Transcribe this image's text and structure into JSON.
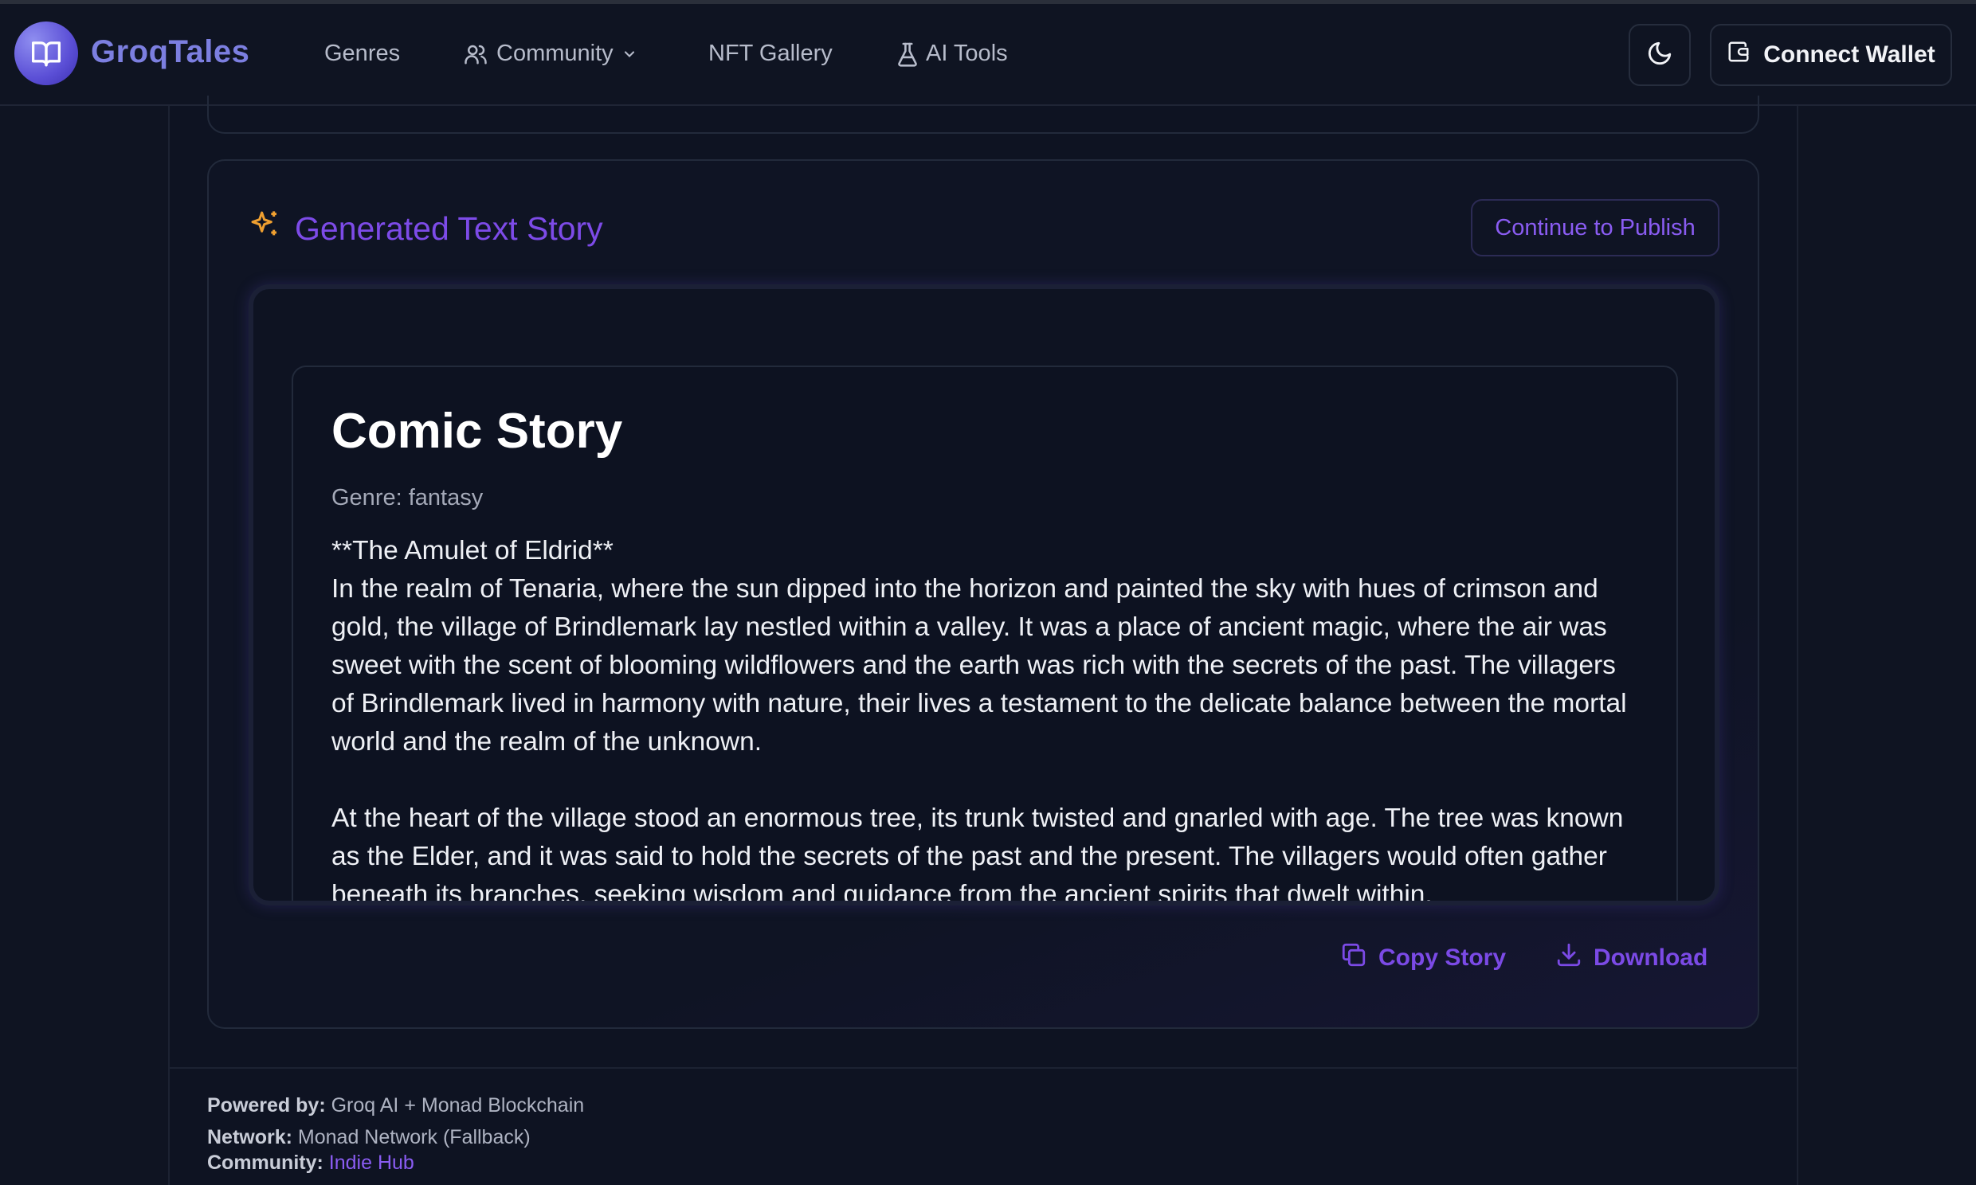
{
  "nav": {
    "brand": "GroqTales",
    "links": {
      "genres": "Genres",
      "community": "Community",
      "nft_gallery": "NFT Gallery",
      "ai_tools": "AI Tools"
    },
    "wallet_button": "Connect Wallet"
  },
  "card": {
    "title": "Generated Text Story",
    "publish_button": "Continue to Publish",
    "story": {
      "title": "Comic Story",
      "genre_label": "Genre: fantasy",
      "heading": "**The Amulet of Eldrid**",
      "paragraph1": "In the realm of Tenaria, where the sun dipped into the horizon and painted the sky with hues of crimson and gold, the village of Brindlemark lay nestled within a valley. It was a place of ancient magic, where the air was sweet with the scent of blooming wildflowers and the earth was rich with the secrets of the past. The villagers of Brindlemark lived in harmony with nature, their lives a testament to the delicate balance between the mortal world and the realm of the unknown.",
      "paragraph2": "At the heart of the village stood an enormous tree, its trunk twisted and gnarled with age. The tree was known as the Elder, and it was said to hold the secrets of the past and the present. The villagers would often gather beneath its branches, seeking wisdom and guidance from the ancient spirits that dwelt within."
    },
    "actions": {
      "copy": "Copy Story",
      "download": "Download"
    }
  },
  "footer": {
    "powered_label": "Powered by:",
    "powered_value": "Groq AI + Monad Blockchain",
    "network_label": "Network:",
    "network_value": "Monad Network (Fallback)",
    "community_label": "Community:",
    "community_value": "Indie Hub"
  },
  "colors": {
    "background": "#0f1422",
    "accent_purple": "#7d4be8",
    "brand_blue": "#7c7fe0",
    "sparkle_orange": "#f0a030"
  }
}
